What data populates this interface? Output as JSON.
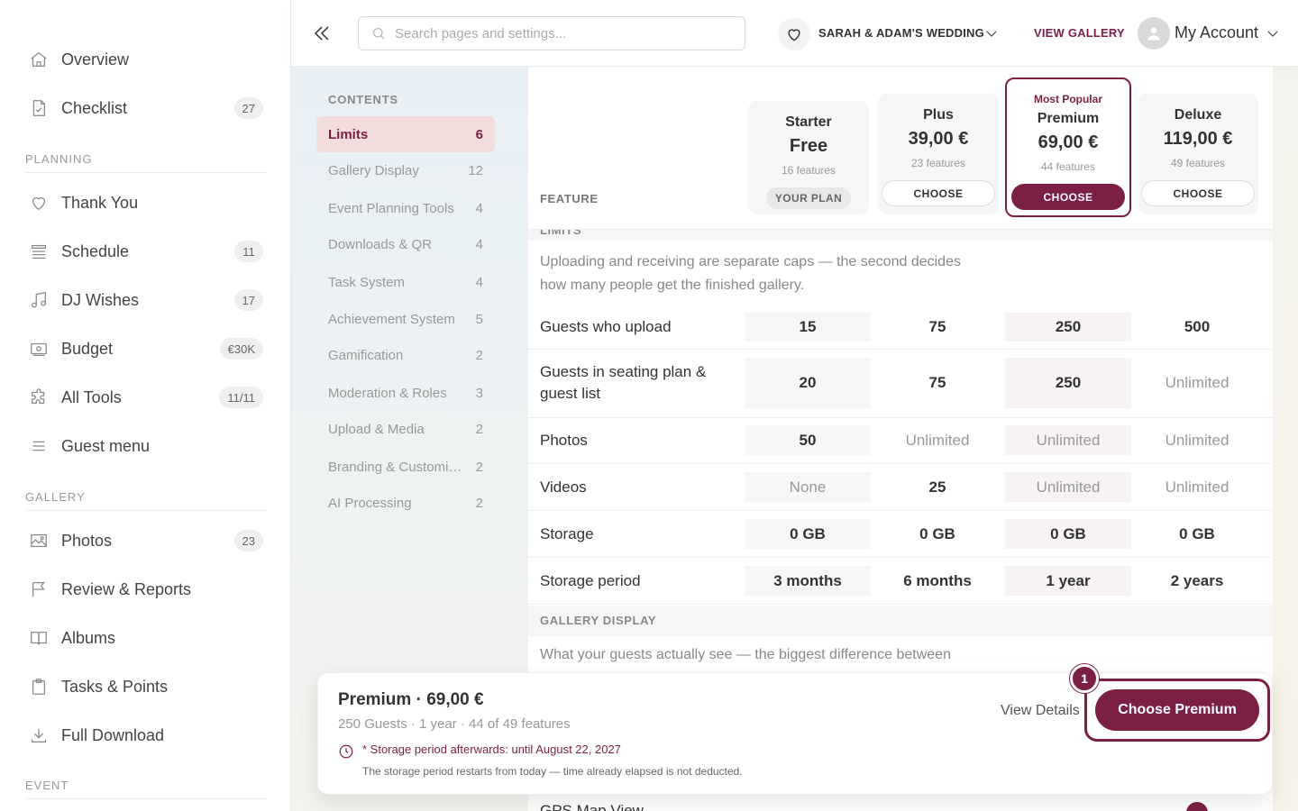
{
  "sidebar": {
    "items_top": [
      {
        "label": "Overview",
        "icon": "home-icon",
        "badge": ""
      },
      {
        "label": "Checklist",
        "icon": "checklist-icon",
        "badge": "27"
      }
    ],
    "sections": [
      {
        "title": "PLANNING"
      },
      {
        "title": "GALLERY"
      },
      {
        "title": "EVENT"
      }
    ],
    "planning": [
      {
        "label": "Thank You",
        "icon": "heart-icon",
        "badge": ""
      },
      {
        "label": "Schedule",
        "icon": "list-icon",
        "badge": "11"
      },
      {
        "label": "DJ Wishes",
        "icon": "music-note-icon",
        "badge": "17"
      },
      {
        "label": "Budget",
        "icon": "money-icon",
        "badge": "€30K"
      },
      {
        "label": "All Tools",
        "icon": "puzzle-icon",
        "badge": "11/11"
      },
      {
        "label": "Guest menu",
        "icon": "menu-icon",
        "badge": ""
      }
    ],
    "gallery": [
      {
        "label": "Photos",
        "icon": "image-icon",
        "badge": "23"
      },
      {
        "label": "Review & Reports",
        "icon": "flag-icon",
        "badge": ""
      },
      {
        "label": "Albums",
        "icon": "book-icon",
        "badge": ""
      },
      {
        "label": "Tasks & Points",
        "icon": "clipboard-icon",
        "badge": ""
      },
      {
        "label": "Full Download",
        "icon": "download-icon",
        "badge": ""
      }
    ]
  },
  "topbar": {
    "search_placeholder": "Search pages and settings...",
    "event_name": "SARAH & ADAM'S WEDDING",
    "view_gallery": "VIEW GALLERY",
    "account": "My Account"
  },
  "contents": {
    "title": "CONTENTS",
    "items": [
      {
        "label": "Limits",
        "count": "6",
        "active": true
      },
      {
        "label": "Gallery Display",
        "count": "12"
      },
      {
        "label": "Event Planning Tools",
        "count": "4"
      },
      {
        "label": "Downloads & QR",
        "count": "4"
      },
      {
        "label": "Task System",
        "count": "4"
      },
      {
        "label": "Achievement System",
        "count": "5"
      },
      {
        "label": "Gamification",
        "count": "2"
      },
      {
        "label": "Moderation & Roles",
        "count": "3"
      },
      {
        "label": "Upload & Media",
        "count": "2"
      },
      {
        "label": "Branding & Customization",
        "count": "2"
      },
      {
        "label": "AI Processing",
        "count": "2"
      }
    ]
  },
  "plans": [
    {
      "tier": "Starter",
      "price": "Free",
      "features": "16 features",
      "action": "YOUR PLAN"
    },
    {
      "tier": "Plus",
      "price": "39,00 €",
      "features": "23 features",
      "action": "CHOOSE"
    },
    {
      "tier": "Premium",
      "price": "69,00 €",
      "features": "44 features",
      "action": "CHOOSE",
      "tag": "Most Popular"
    },
    {
      "tier": "Deluxe",
      "price": "119,00 €",
      "features": "49 features",
      "action": "CHOOSE"
    }
  ],
  "table": {
    "feature_header": "FEATURE",
    "limits_section": "LIMITS",
    "limits_desc_1": "Uploading and receiving are separate caps — the second decides",
    "limits_desc_2": "how many people get the finished gallery.",
    "rows": [
      {
        "label": "Guests who upload",
        "values": [
          "15",
          "75",
          "250",
          "500"
        ]
      },
      {
        "label": "Guests in seating plan & guest list",
        "values": [
          "20",
          "75",
          "250",
          "Unlimited"
        ]
      },
      {
        "label": "Photos",
        "values": [
          "50",
          "Unlimited",
          "Unlimited",
          "Unlimited"
        ]
      },
      {
        "label": "Videos",
        "values": [
          "None",
          "25",
          "Unlimited",
          "Unlimited"
        ]
      },
      {
        "label": "Storage",
        "values": [
          "0 GB",
          "0 GB",
          "0 GB",
          "0 GB"
        ]
      },
      {
        "label": "Storage period",
        "values": [
          "3 months",
          "6 months",
          "1 year",
          "2 years"
        ]
      }
    ],
    "gallery_section": "GALLERY DISPLAY",
    "gallery_desc": "What your guests actually see — the biggest difference between",
    "peek_row": "GPS Map View"
  },
  "bottom_bar": {
    "title": "Premium · 69,00 €",
    "subtitle": "250 Guests · 1 year · 44 of 49 features",
    "note": "* Storage period afterwards: until August 22, 2027",
    "small": "The storage period restarts from today — time already elapsed is not deducted.",
    "view_details": "View Details",
    "cta": "Choose Premium",
    "step": "1"
  },
  "colors": {
    "accent": "#7b1f45",
    "highlight": "#f2dcdc"
  }
}
